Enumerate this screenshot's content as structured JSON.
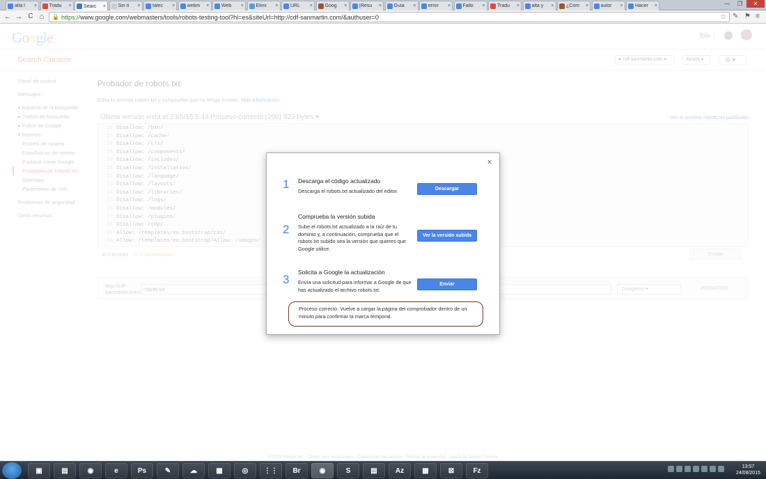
{
  "browser": {
    "tabs": [
      {
        "title": "alta l",
        "color": "#4a86e8"
      },
      {
        "title": "Tradu",
        "color": "#dd4b39"
      },
      {
        "title": "Searc",
        "color": "#3a7bd5",
        "active": true
      },
      {
        "title": "Sin tí",
        "color": "#cccccc"
      },
      {
        "title": "tatec",
        "color": "#4a86e8"
      },
      {
        "title": "webm",
        "color": "#4a86e8"
      },
      {
        "title": "Web",
        "color": "#4a86e8"
      },
      {
        "title": "Elimi",
        "color": "#5a9bd5"
      },
      {
        "title": "URL",
        "color": "#4a86e8"
      },
      {
        "title": "Goog",
        "color": "#a0522d"
      },
      {
        "title": "[Resu",
        "color": "#4a86e8"
      },
      {
        "title": "Guía",
        "color": "#4a86e8"
      },
      {
        "title": "error",
        "color": "#4a86e8"
      },
      {
        "title": "Fallo",
        "color": "#4a86e8"
      },
      {
        "title": "Tradu",
        "color": "#dd4b39"
      },
      {
        "title": "alta y",
        "color": "#4a86e8"
      },
      {
        "title": "¿Cóm",
        "color": "#a0522d"
      },
      {
        "title": "autor",
        "color": "#4a86e8"
      },
      {
        "title": "Hacer",
        "color": "#4a86e8"
      }
    ],
    "window_controls": {
      "minimize": "—",
      "maximize": "❐",
      "close": "✕"
    },
    "url_https": "https://",
    "url_rest": "www.google.com/webmasters/tools/robots-testing-tool?hl=es&siteUrl=http://cdf-sanmartin.com/&authuser=0",
    "nav": {
      "back": "←",
      "forward": "→",
      "reload": "C",
      "home": "⌂"
    }
  },
  "google_bar": {
    "logo": "Google",
    "user": "Elra"
  },
  "search_console": {
    "title": "Search Console",
    "site": "cdf-sanmartin.com",
    "help": "Ayuda"
  },
  "sidebar": {
    "items": [
      {
        "label": "Panel de control",
        "type": "top"
      },
      {
        "label": "Mensajes",
        "type": "top"
      },
      {
        "label": "▸ Aspecto de la búsqueda",
        "type": "top"
      },
      {
        "label": "▸ Tráfico de búsqueda",
        "type": "top"
      },
      {
        "label": "▸ Índice de Google",
        "type": "top"
      },
      {
        "label": "▾ Rastreo",
        "type": "top"
      },
      {
        "label": "Errores de rastreo",
        "type": "sub"
      },
      {
        "label": "Estadísticas de rastreo",
        "type": "sub"
      },
      {
        "label": "Explorar como Google",
        "type": "sub"
      },
      {
        "label": "Probador de robots.txt",
        "type": "sub",
        "active": true
      },
      {
        "label": "Sitemaps",
        "type": "sub"
      },
      {
        "label": "Parámetros de URL",
        "type": "sub"
      },
      {
        "label": "Problemas de seguridad",
        "type": "top"
      },
      {
        "label": "Otros recursos",
        "type": "top"
      }
    ]
  },
  "main": {
    "title": "Probador de robots.txt",
    "description": "Edita tu archivo robots.txt y comprueba que no tenga errores.",
    "more_info": "Más información",
    "version": "Última versión vista el 23/8/15 5:44 Proceso correcto (200) 923 bytes ▾",
    "view_published": "Ver el archivo robots.txt publicado",
    "code_lines": [
      {
        "n": "16",
        "t": "Disallow: /bin/"
      },
      {
        "n": "17",
        "t": "Disallow: /cache/"
      },
      {
        "n": "18",
        "t": "Disallow: /cli/"
      },
      {
        "n": "19",
        "t": "Disallow: /components/"
      },
      {
        "n": "20",
        "t": "Disallow: /includes/"
      },
      {
        "n": "21",
        "t": "Disallow: /installation/"
      },
      {
        "n": "22",
        "t": "Disallow: /language/"
      },
      {
        "n": "23",
        "t": "Disallow: /layouts/"
      },
      {
        "n": "24",
        "t": "Disallow: /libraries/"
      },
      {
        "n": "25",
        "t": "Disallow: /logs/"
      },
      {
        "n": "26",
        "t": "Disallow: /modules/"
      },
      {
        "n": "27",
        "t": "Disallow: /plugins/"
      },
      {
        "n": "28",
        "t": "Disallow: /tmp/"
      },
      {
        "n": "29",
        "t": "Allow: /templates/eo_bootstrap/css/"
      },
      {
        "n": "30",
        "t": "Allow: /templates/eo_bootstrap/Allow: /images/"
      }
    ],
    "errors": "⊗ 0 errores",
    "warnings": "⚠ 0 advertencias",
    "submit": "Enviar",
    "test_prefix": "http://cdf-sanmartin.com/",
    "test_value": "robots.txt",
    "bot": "Googlebot",
    "test_result": "PERMITIDO"
  },
  "dialog": {
    "close": "×",
    "steps": [
      {
        "num": "1",
        "title": "Descarga el código actualizado",
        "desc": "Descarga el robots.txt actualizado del editor.",
        "button": "Descargar"
      },
      {
        "num": "2",
        "title": "Comprueba la versión subida",
        "desc": "Sube el robots.txt actualizado a la raíz de tu dominio y, a continuación, comprueba que el robots.txt subido sea la versión que quieres que Google utilice.",
        "button": "Ver la versión subida"
      },
      {
        "num": "3",
        "title": "Solicita a Google la actualización",
        "desc": "Envía una solicitud para informar a Google de que has actualizado el archivo robots.txt.",
        "button": "Enviar"
      }
    ],
    "status": "Proceso correcto. Vuelve a cargar la página del comprobador dentro de un minuto para confirmar la marca temporal."
  },
  "footer": "© 2015 Google Inc. - Centro para webmasters - Condiciones del servicio - Política de privacidad - Ayuda de Search Console",
  "taskbar": {
    "items": [
      "▣",
      "▤",
      "◉",
      "e",
      "Ps",
      "✎",
      "☁",
      "▦",
      "◎",
      "⋮⋮",
      "Br",
      "◉",
      "S",
      "▤",
      "Az",
      "▦",
      "⊠",
      "Fz"
    ],
    "time": "13:57",
    "date": "24/08/2015"
  },
  "colors": {
    "accent": "#4a86e8",
    "brand_red": "#dd4b39",
    "status_border": "#6b3a24"
  }
}
